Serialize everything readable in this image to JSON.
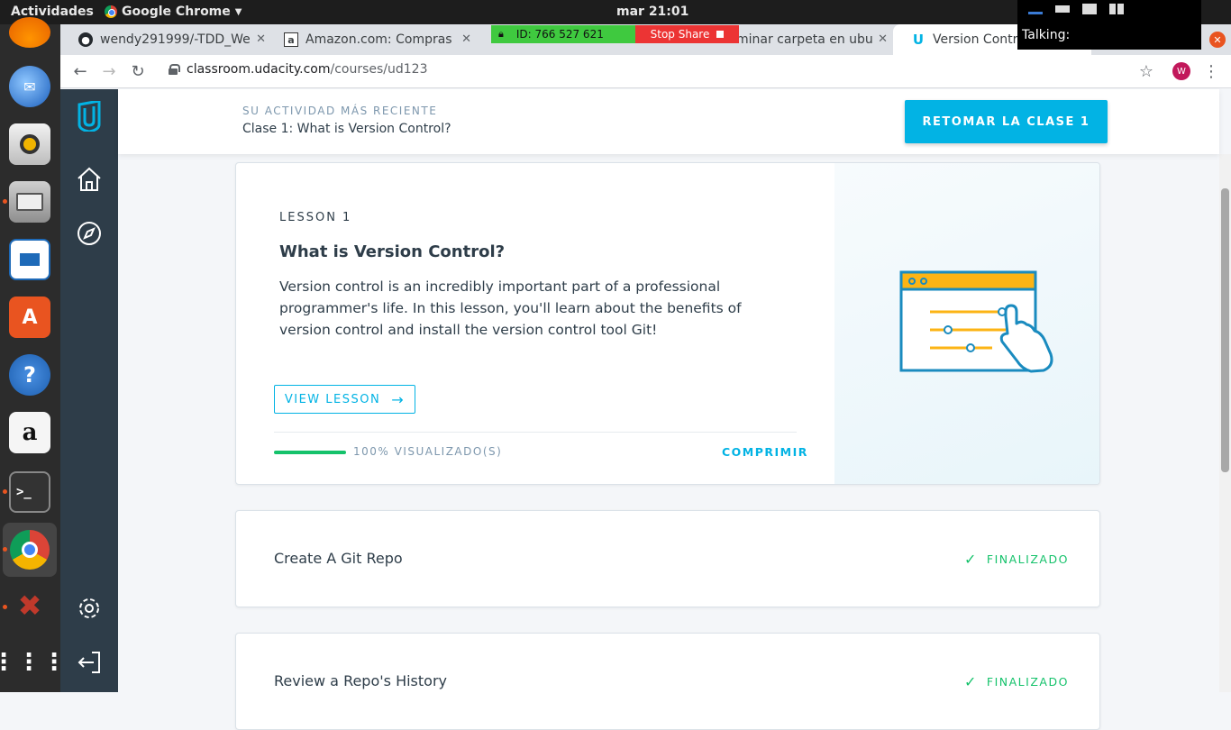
{
  "system": {
    "activities": "Actividades",
    "app_name": "Google Chrome",
    "clock": "mar 21:01"
  },
  "screen_share": {
    "id_label": "ID: 766 527 621",
    "stop_label": "Stop Share",
    "talking_label": "Talking:"
  },
  "browser": {
    "tabs": [
      {
        "title": "wendy291999/-TDD_We"
      },
      {
        "title": "Amazon.com: Compras"
      },
      {
        "title": "minar carpeta en ubu"
      },
      {
        "title": "Version Control"
      }
    ],
    "url_host": "classroom.udacity.com",
    "url_path": "/courses/ud123",
    "profile_initial": "W"
  },
  "recent": {
    "label": "SU ACTIVIDAD MÁS RECIENTE",
    "class_name": "Clase 1: What is Version Control?",
    "resume_button": "RETOMAR LA CLASE 1"
  },
  "lesson": {
    "number_label": "LESSON 1",
    "title": "What is Version Control?",
    "description": "Version control is an incredibly important part of a professional programmer's life. In this lesson, you'll learn about the benefits of version control and install the version control tool Git!",
    "view_button": "VIEW LESSON",
    "progress_fraction": 1.0,
    "progress_label": "100% VISUALIZADO(S)",
    "collapse_label": "COMPRIMIR"
  },
  "concepts": [
    {
      "title": "Create A Git Repo",
      "status": "FINALIZADO"
    },
    {
      "title": "Review a Repo's History",
      "status": "FINALIZADO"
    }
  ],
  "colors": {
    "udacity_blue": "#02b3e4",
    "sidebar": "#2e3d49",
    "success": "#15c26b",
    "illustration_yellow": "#fcb415"
  }
}
